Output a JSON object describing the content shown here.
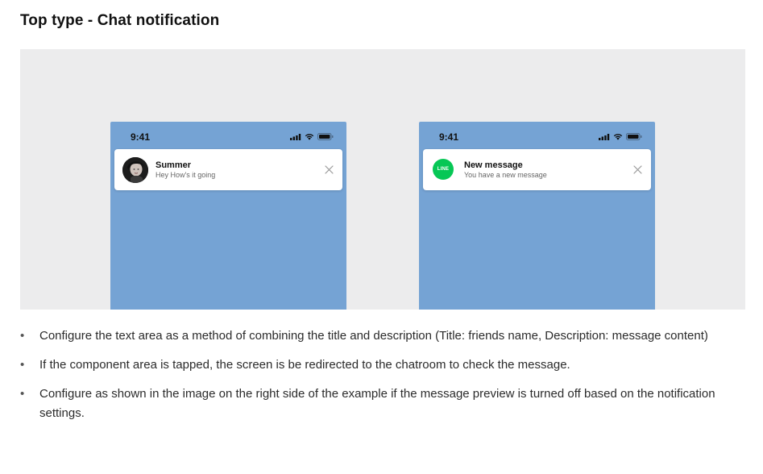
{
  "page": {
    "title": "Top type - Chat notification"
  },
  "colors": {
    "preview_background": "#ececed",
    "phone_background": "#75a3d4",
    "line_green": "#06c755"
  },
  "phones": [
    {
      "status_time": "9:41",
      "notification": {
        "icon": "profile-avatar",
        "title": "Summer",
        "description": "Hey How's it going"
      }
    },
    {
      "status_time": "9:41",
      "notification": {
        "icon": "line-logo",
        "logo_text": "LINE",
        "title": "New message",
        "description": "You have a new message"
      }
    }
  ],
  "bullets": [
    "Configure the text area as a method of combining the title and description (Title: friends name, Description: message content)",
    "If the component area is tapped, the screen is be redirected to the chatroom to check the message.",
    "Configure as shown in the image on the right side of the example if the message preview is turned off based on the notification settings."
  ],
  "bullet_symbol": "•"
}
